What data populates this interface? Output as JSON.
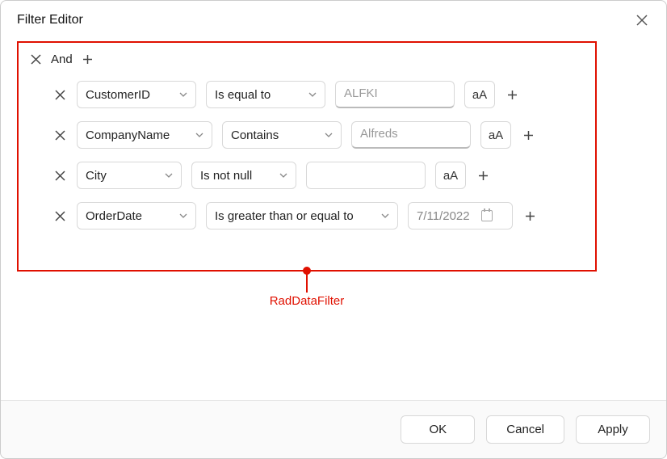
{
  "dialog": {
    "title": "Filter Editor"
  },
  "group": {
    "operator": "And"
  },
  "case_label": "aA",
  "rows": [
    {
      "field": "CustomerID",
      "operator": "Is equal to",
      "value": "ALFKI",
      "value_is_placeholder": true,
      "show_case": true
    },
    {
      "field": "CompanyName",
      "operator": "Contains",
      "value": "Alfreds",
      "value_is_placeholder": true,
      "show_case": true
    },
    {
      "field": "City",
      "operator": "Is not null",
      "value": "",
      "value_is_placeholder": false,
      "show_case": true
    },
    {
      "field": "OrderDate",
      "operator": "Is greater than or equal to",
      "value": "7/11/2022",
      "is_date": true,
      "show_case": false
    }
  ],
  "annotation": {
    "label": "RadDataFilter"
  },
  "buttons": {
    "ok": "OK",
    "cancel": "Cancel",
    "apply": "Apply"
  },
  "widths": {
    "field": [
      148,
      168,
      130,
      148
    ],
    "operator": [
      148,
      148,
      130,
      238
    ],
    "value": [
      148,
      148,
      148,
      0
    ]
  }
}
